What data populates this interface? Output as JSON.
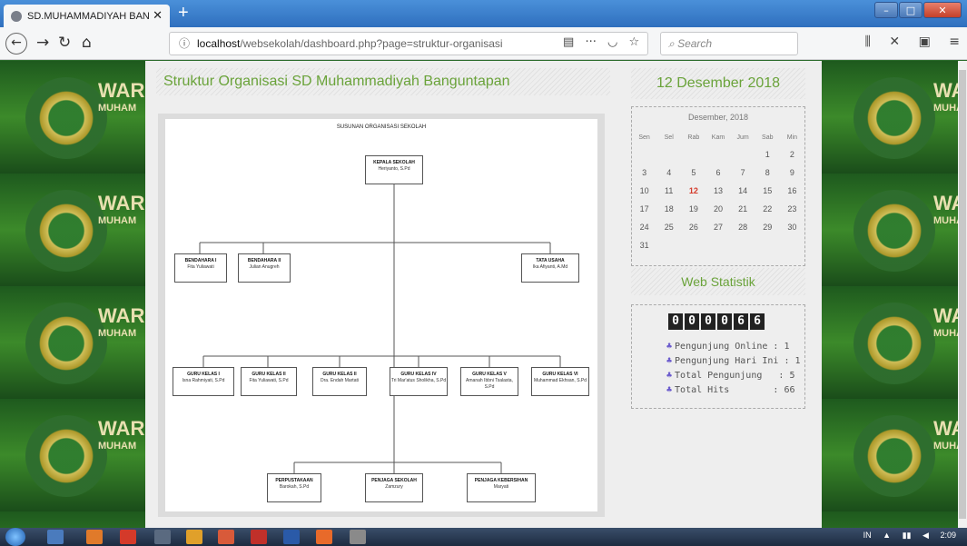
{
  "browser": {
    "tab_title": "SD.MUHAMMADIYAH BANGU",
    "url_host": "localhost",
    "url_path": "/websekolah/dashboard.php?page=struktur-organisasi",
    "search_placeholder": "Search"
  },
  "page": {
    "title": "Struktur Organisasi SD Muhammadiyah Banguntapan",
    "bg_wordmark": "WARI",
    "bg_wordmark_sub": "MUHAM"
  },
  "org": {
    "heading": "SUSUNAN ORGANISASI SEKOLAH",
    "head": {
      "title": "KEPALA SEKOLAH",
      "name": "Heriyanto, S.Pd"
    },
    "admin": [
      {
        "title": "BENDAHARA I",
        "name": "Fita Yuliawati"
      },
      {
        "title": "BENDAHARA II",
        "name": "Julian Anugreh"
      },
      {
        "title": "TATA USAHA",
        "name": "Ika Afiyanti, A.Md"
      }
    ],
    "teachers": [
      {
        "title": "GURU KELAS I",
        "name": "Isna Rahmiyati, S.Pd"
      },
      {
        "title": "GURU KELAS II",
        "name": "Fita Yuliawati, S.Pd"
      },
      {
        "title": "GURU KELAS II",
        "name": "Dra. Endah Martati"
      },
      {
        "title": "GURU KELAS IV",
        "name": "Tri Mar'atus Sholikha, S.Pd"
      },
      {
        "title": "GURU KELAS V",
        "name": "Amanah Ibbni Tsalasta, S.Pd"
      },
      {
        "title": "GURU KELAS VI",
        "name": "Muhammad Ekhsan, S.Pd"
      }
    ],
    "staff": [
      {
        "title": "PERPUSTAKAAN",
        "name": "Barokah, S.Pd"
      },
      {
        "title": "PENJAGA SEKOLAH",
        "name": "Zamzury"
      },
      {
        "title": "PENJAGA KEBERSIHAN",
        "name": "Maryati"
      }
    ]
  },
  "sidebar": {
    "date_title": "12 Desember 2018",
    "calendar": {
      "month_label": "Desember, 2018",
      "days": [
        "Sen",
        "Sel",
        "Rab",
        "Kam",
        "Jum",
        "Sab",
        "Min"
      ],
      "cells": [
        "",
        "",
        "",
        "",
        "",
        "1",
        "2",
        "3",
        "4",
        "5",
        "6",
        "7",
        "8",
        "9",
        "10",
        "11",
        "12",
        "13",
        "14",
        "15",
        "16",
        "17",
        "18",
        "19",
        "20",
        "21",
        "22",
        "23",
        "24",
        "25",
        "26",
        "27",
        "28",
        "29",
        "30",
        "31",
        "",
        "",
        "",
        "",
        "",
        ""
      ],
      "today": "12",
      "today_color": "#d43a2a"
    },
    "stat_title": "Web Statistik",
    "counter_digits": [
      "0",
      "0",
      "0",
      "0",
      "6",
      "6"
    ],
    "stats": [
      {
        "label": "Pengunjung Online",
        "value": ": 1",
        "icon": "users-icon"
      },
      {
        "label": "Pengunjung Hari Ini",
        "value": ": 1",
        "icon": "users-icon"
      },
      {
        "label": "Total Pengunjung",
        "value": ": 5",
        "icon": "users-icon"
      },
      {
        "label": "Total Hits",
        "value": ": 66",
        "icon": "users-icon"
      }
    ]
  },
  "taskbar": {
    "lang": "IN",
    "clock": "2:09"
  },
  "colors": {
    "accent_green": "#6aa33a",
    "today_red": "#d43a2a"
  }
}
